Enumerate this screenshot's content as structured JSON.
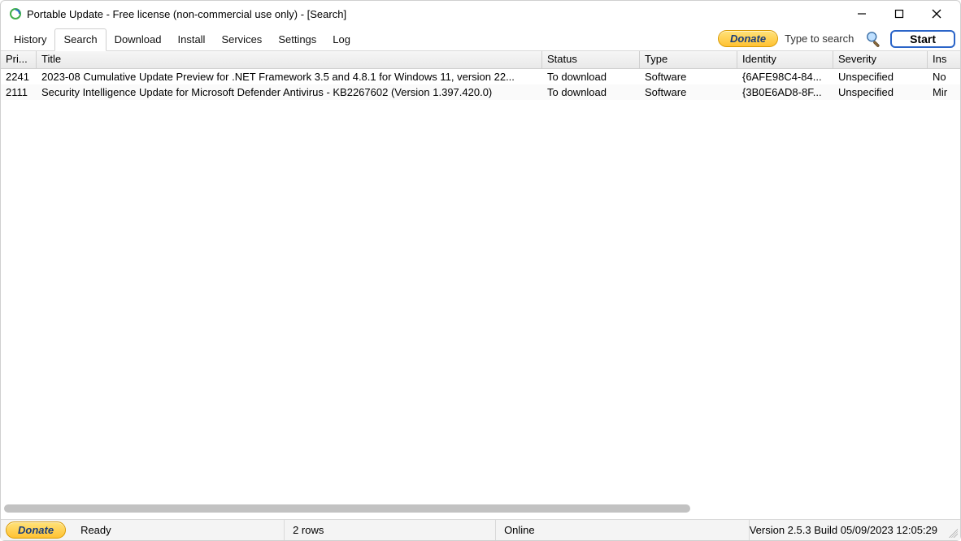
{
  "titlebar": {
    "title": "Portable Update  - Free license (non-commercial use only) - [Search]"
  },
  "tabs": [
    {
      "label": "History",
      "active": false
    },
    {
      "label": "Search",
      "active": true
    },
    {
      "label": "Download",
      "active": false
    },
    {
      "label": "Install",
      "active": false
    },
    {
      "label": "Services",
      "active": false
    },
    {
      "label": "Settings",
      "active": false
    },
    {
      "label": "Log",
      "active": false
    }
  ],
  "toolbar": {
    "donate_label": "Donate",
    "search_placeholder": "Type to search",
    "start_label": "Start"
  },
  "columns": {
    "priority": "Pri...",
    "title": "Title",
    "status": "Status",
    "type": "Type",
    "identity": "Identity",
    "severity": "Severity",
    "installed": "Ins"
  },
  "rows": [
    {
      "priority": "2241",
      "title": "2023-08 Cumulative Update Preview for .NET Framework 3.5 and 4.8.1 for Windows 11, version 22...",
      "status": "To download",
      "type": "Software",
      "identity": "{6AFE98C4-84...",
      "severity": "Unspecified",
      "installed": "No"
    },
    {
      "priority": "2111",
      "title": "Security Intelligence Update for Microsoft Defender Antivirus - KB2267602 (Version 1.397.420.0)",
      "status": "To download",
      "type": "Software",
      "identity": "{3B0E6AD8-8F...",
      "severity": "Unspecified",
      "installed": "Mir"
    }
  ],
  "statusbar": {
    "donate_label": "Donate",
    "ready": "Ready",
    "rowcount": "2 rows",
    "online": "Online",
    "version": "Version 2.5.3 Build 05/09/2023 12:05:29"
  }
}
